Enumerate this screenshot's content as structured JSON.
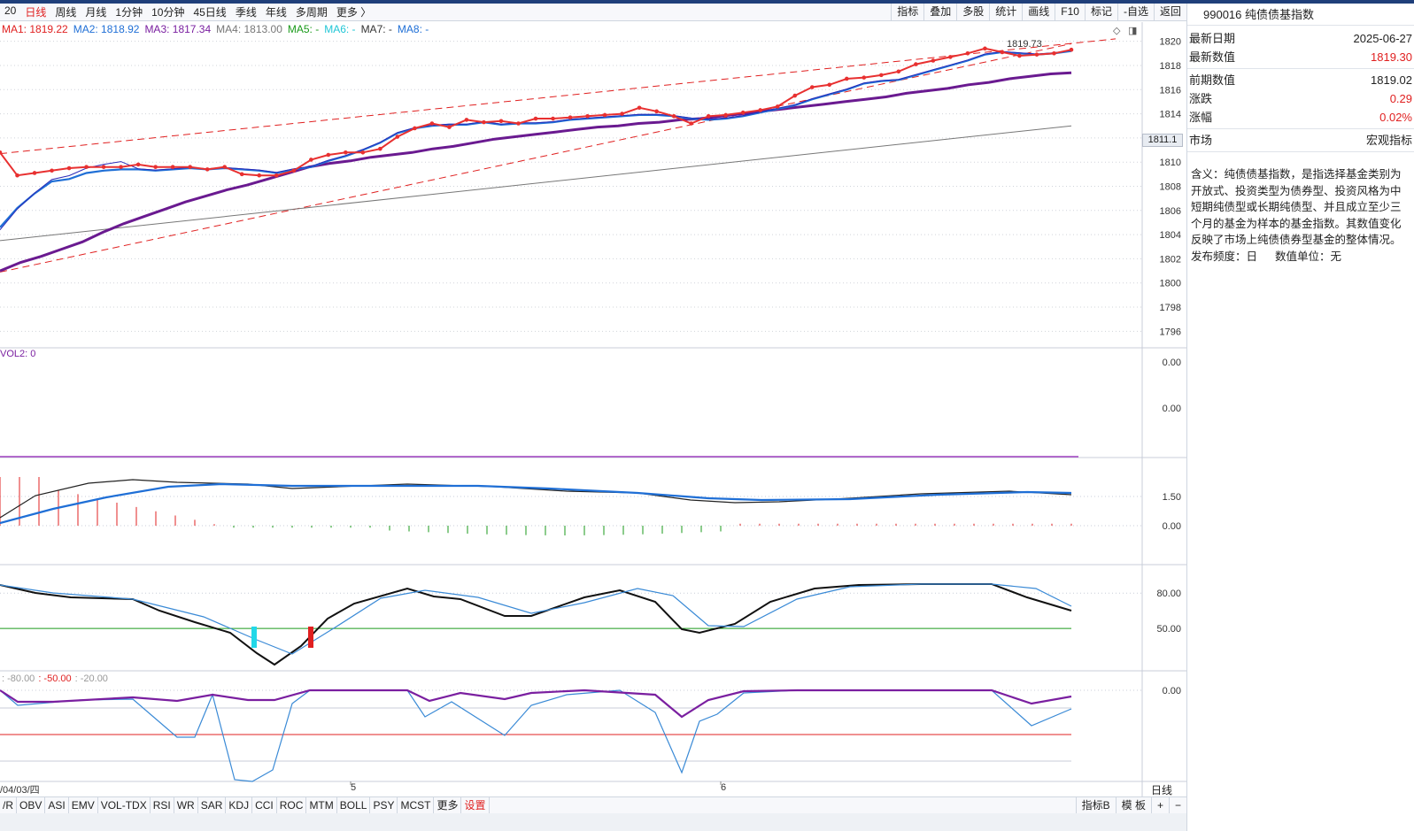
{
  "period_tabs": [
    "20",
    "日线",
    "周线",
    "月线",
    "1分钟",
    "10分钟",
    "45日线",
    "季线",
    "年线",
    "多周期",
    "更多 〉"
  ],
  "active_period": "日线",
  "tools": [
    "指标",
    "叠加",
    "多股",
    "统计",
    "画线",
    "F10",
    "标记",
    "-自选",
    "返回"
  ],
  "ma_legend": [
    {
      "label": "MA1: 1819.22",
      "color": "#e02020"
    },
    {
      "label": "MA2: 1818.92",
      "color": "#1f6fd6"
    },
    {
      "label": "MA3: 1817.34",
      "color": "#7a1fa0"
    },
    {
      "label": "MA4: 1813.00",
      "color": "#777777"
    },
    {
      "label": "MA5: -",
      "color": "#1a9a1a"
    },
    {
      "label": "MA6: -",
      "color": "#21c6d6"
    },
    {
      "label": "MA7: -",
      "color": "#333333"
    },
    {
      "label": "MA8: -",
      "color": "#1f6fd6"
    }
  ],
  "price_axis": [
    "1820",
    "1818",
    "1816",
    "1814",
    "1812",
    "1810",
    "1808",
    "1806",
    "1804",
    "1802",
    "1800",
    "1798",
    "1796"
  ],
  "price_tag": "1811.1",
  "peak_label": "1819.73",
  "vol2_label": "VOL2: 0",
  "vol_axis": [
    "0.00",
    "0.00"
  ],
  "macd_axis": [
    "1.50",
    "0.00"
  ],
  "kdj_axis": [
    "80.00",
    "50.00"
  ],
  "wr_axis": [
    "0.00"
  ],
  "wr_legend": {
    "a": ": -80.00",
    "b": ": -50.00",
    "c": ": -20.00"
  },
  "x_labels": [
    {
      "t": "/04/03/四"
    },
    {
      "t": "5"
    },
    {
      "t": "6"
    }
  ],
  "x_right_label": "日线",
  "indicator_tabs": [
    "/R",
    "OBV",
    "ASI",
    "EMV",
    "VOL-TDX",
    "RSI",
    "WR",
    "SAR",
    "KDJ",
    "CCI",
    "ROC",
    "MTM",
    "BOLL",
    "PSY",
    "MCST",
    "更多",
    "设置"
  ],
  "bottom_right": [
    "指标B",
    "模 板",
    "+",
    "−"
  ],
  "panel": {
    "title": "990016 纯债债基指数",
    "rows1": [
      {
        "k": "最新日期",
        "v": "2025-06-27",
        "color": "#222222"
      },
      {
        "k": "最新数值",
        "v": "1819.30",
        "color": "#e02020"
      }
    ],
    "rows2": [
      {
        "k": "前期数值",
        "v": "1819.02",
        "color": "#222222"
      },
      {
        "k": "涨跌",
        "v": "0.29",
        "color": "#e02020"
      },
      {
        "k": "涨幅",
        "v": "0.02%",
        "color": "#e02020"
      }
    ],
    "rows3": [
      {
        "k": "市场",
        "v": "宏观指标",
        "color": "#222222"
      }
    ],
    "description": "含义：纯债债基指数，是指选择基金类别为开放式、投资类型为债券型、投资风格为中短期纯债型或长期纯债型、并且成立至少三个月的基金为样本的基金指数。其数值变化反映了市场上纯债债券型基金的整体情况。",
    "freq": "发布频度：日",
    "unit": "数值单位：无"
  },
  "chart_data": {
    "type": "line",
    "price_range": [
      1795,
      1821
    ],
    "ma1": [
      1810.8,
      1808.9,
      1809.1,
      1809.3,
      1809.5,
      1809.6,
      1809.6,
      1809.6,
      1809.8,
      1809.6,
      1809.6,
      1809.6,
      1809.4,
      1809.6,
      1809.0,
      1808.9,
      1808.9,
      1809.3,
      1810.2,
      1810.6,
      1810.8,
      1810.8,
      1811.1,
      1812.1,
      1812.8,
      1813.2,
      1812.9,
      1813.5,
      1813.3,
      1813.4,
      1813.2,
      1813.6,
      1813.6,
      1813.7,
      1813.8,
      1813.9,
      1814.0,
      1814.5,
      1814.2,
      1813.8,
      1813.2,
      1813.8,
      1813.9,
      1814.1,
      1814.3,
      1814.6,
      1815.5,
      1816.2,
      1816.4,
      1816.9,
      1817.0,
      1817.2,
      1817.5,
      1818.1,
      1818.4,
      1818.7,
      1819.0,
      1819.4,
      1819.1,
      1818.8,
      1818.9,
      1819.0,
      1819.3
    ],
    "ma2": [
      1804.6,
      1806.2,
      1807.4,
      1808.4,
      1808.6,
      1809.1,
      1809.3,
      1809.4,
      1809.4,
      1809.3,
      1809.4,
      1809.5,
      1809.4,
      1809.5,
      1809.4,
      1809.3,
      1809.1,
      1809.4,
      1809.6,
      1810.1,
      1810.5,
      1811.0,
      1811.6,
      1812.4,
      1812.8,
      1813.0,
      1813.1,
      1813.1,
      1813.3,
      1813.1,
      1813.2,
      1813.2,
      1813.3,
      1813.5,
      1813.6,
      1813.7,
      1813.8,
      1813.9,
      1813.9,
      1813.8,
      1813.6,
      1813.5,
      1813.6,
      1813.8,
      1814.1,
      1814.4,
      1814.7,
      1815.2,
      1815.6,
      1816.0,
      1816.5,
      1816.7,
      1816.8,
      1817.2,
      1817.6,
      1818.0,
      1818.4,
      1818.9,
      1819.1,
      1819.0,
      1818.9,
      1819.0,
      1819.2
    ],
    "ma3": [
      1801.0,
      1801.7,
      1802.2,
      1802.8,
      1803.4,
      1804.2,
      1804.9,
      1805.5,
      1806.1,
      1806.7,
      1807.2,
      1807.7,
      1808.1,
      1808.6,
      1809.1,
      1809.6,
      1809.9,
      1810.1,
      1810.4,
      1810.6,
      1810.8,
      1811.1,
      1811.3,
      1811.6,
      1811.9,
      1812.1,
      1812.3,
      1812.5,
      1812.7,
      1812.9,
      1813.0,
      1813.2,
      1813.3,
      1813.5,
      1813.6,
      1813.8,
      1814.0,
      1814.2,
      1814.4,
      1814.6,
      1814.8,
      1815.0,
      1815.2,
      1815.4,
      1815.7,
      1815.9,
      1816.1,
      1816.4,
      1816.6,
      1816.9,
      1817.1,
      1817.3,
      1817.4
    ],
    "ma4": [
      1803.5,
      1813.0
    ]
  }
}
